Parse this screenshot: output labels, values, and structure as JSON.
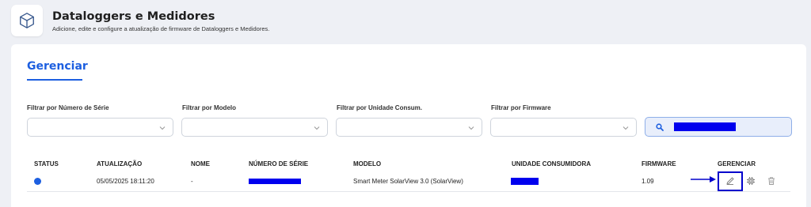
{
  "header": {
    "icon": "cube-icon",
    "title": "Dataloggers e Medidores",
    "subtitle": "Adicione, edite e configure a atualização de firmware de Dataloggers e Medidores."
  },
  "tabs": [
    {
      "label": "Gerenciar",
      "active": true
    }
  ],
  "filters": {
    "serial_label": "Filtrar por Número de Série",
    "model_label": "Filtrar por Modelo",
    "unit_label": "Filtrar por Unidade Consum.",
    "firmware_label": "Filtrar por Firmware"
  },
  "search": {
    "icon": "search-icon",
    "value_redacted": true
  },
  "table": {
    "columns": [
      "STATUS",
      "ATUALIZAÇÃO",
      "NOME",
      "NÚMERO DE SÉRIE",
      "MODELO",
      "UNIDADE CONSUMIDORA",
      "FIRMWARE",
      "GERENCIAR"
    ],
    "rows": [
      {
        "status_color": "#1d5fe0",
        "updated": "05/05/2025 18:11:20",
        "name": "-",
        "serial_redacted": true,
        "model": "Smart Meter SolarView 3.0 (SolarView)",
        "unit_redacted": true,
        "firmware": "1.09",
        "actions": [
          "edit-icon",
          "chip-icon",
          "trash-icon"
        ]
      }
    ]
  },
  "colors": {
    "accent": "#1d5fe0",
    "annotation": "#0000cc"
  }
}
